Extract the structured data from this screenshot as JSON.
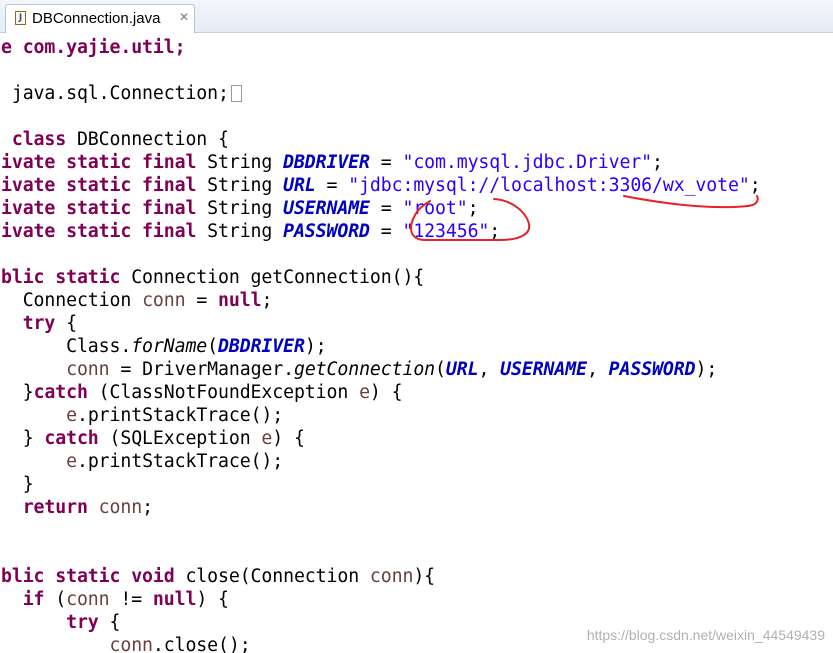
{
  "tab": {
    "title": "DBConnection.java",
    "icon": "java-file-icon",
    "close_glyph": "✕"
  },
  "code": {
    "l1": {
      "a": "e com.yajie.util;"
    },
    "l3": {
      "a": " java.sql.Connection;"
    },
    "l5": {
      "a": " ",
      "b": "class",
      "c": " DBConnection {"
    },
    "l6": {
      "a": "ivate static final",
      "b": " String ",
      "c": "DBDRIVER",
      "d": " = ",
      "e": "\"com.mysql.jdbc.Driver\"",
      "f": ";"
    },
    "l7": {
      "a": "ivate static final",
      "b": " String ",
      "c": "URL",
      "d": " = ",
      "e": "\"jdbc:mysql://localhost:3306/wx_vote\"",
      "f": ";"
    },
    "l8": {
      "a": "ivate static final",
      "b": " String ",
      "c": "USERNAME",
      "d": " = ",
      "e": "\"root\"",
      "f": ";"
    },
    "l9": {
      "a": "ivate static final",
      "b": " String ",
      "c": "PASSWORD",
      "d": " = ",
      "e": "\"123456\"",
      "f": ";"
    },
    "l11": {
      "a": "blic static",
      "b": " Connection getConnection(){"
    },
    "l12": {
      "a": "  Connection ",
      "b": "conn",
      "c": " = ",
      "d": "null",
      "e": ";"
    },
    "l13": {
      "a": "  ",
      "b": "try",
      "c": " {"
    },
    "l14": {
      "a": "      Class.",
      "b": "forName",
      "c": "(",
      "d": "DBDRIVER",
      "e": ");"
    },
    "l15": {
      "a": "      ",
      "b": "conn",
      "c": " = DriverManager.",
      "d": "getConnection",
      "e": "(",
      "f": "URL",
      "g": ", ",
      "h": "USERNAME",
      "i": ", ",
      "j": "PASSWORD",
      "k": ");"
    },
    "l16": {
      "a": "  }",
      "b": "catch",
      "c": " (ClassNotFoundException ",
      "d": "e",
      "e": ") {"
    },
    "l17": {
      "a": "      ",
      "b": "e",
      "c": ".printStackTrace();"
    },
    "l18": {
      "a": "  } ",
      "b": "catch",
      "c": " (SQLException ",
      "d": "e",
      "e": ") {"
    },
    "l19": {
      "a": "      ",
      "b": "e",
      "c": ".printStackTrace();"
    },
    "l20": {
      "a": "  }"
    },
    "l21": {
      "a": "  ",
      "b": "return",
      "c": " ",
      "d": "conn",
      "e": ";"
    },
    "l24": {
      "a": "blic static void",
      "b": " close(Connection ",
      "c": "conn",
      "d": "){"
    },
    "l25": {
      "a": "  ",
      "b": "if",
      "c": " (",
      "d": "conn",
      "e": " != ",
      "f": "null",
      "g": ") {"
    },
    "l26": {
      "a": "      ",
      "b": "try",
      "c": " {"
    },
    "l27": {
      "a": "          ",
      "b": "conn",
      "c": ".close();"
    }
  },
  "colors": {
    "keyword": "#7f0055",
    "string": "#2a00ff",
    "field": "#0000c0",
    "local_var": "#6a3e3e",
    "annotation": "#e8202a"
  },
  "watermark": "https://blog.csdn.net/weixin_44549439"
}
